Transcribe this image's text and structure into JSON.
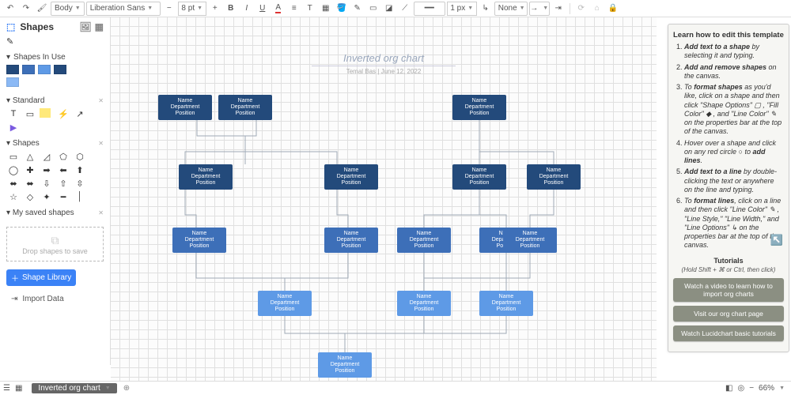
{
  "toolbar": {
    "style_select": "Body",
    "font_select": "Liberation Sans",
    "font_size": "8 pt",
    "line_width": "1 px",
    "arrow_start": "None"
  },
  "shapes_panel": {
    "title": "Shapes",
    "section_in_use": "Shapes In Use",
    "section_standard": "Standard",
    "section_shapes": "Shapes",
    "section_saved": "My saved shapes",
    "drop_hint": "Drop shapes to save",
    "lib_btn": "Shape Library",
    "import_btn": "Import Data"
  },
  "canvas": {
    "title": "Inverted org chart",
    "subtitle": "Temal Bas  |  June 12, 2022",
    "node_lines": [
      "Name",
      "Department",
      "Position"
    ]
  },
  "help": {
    "title": "Learn how to edit this template",
    "items": [
      {
        "bold": "Add text to a shape",
        "rest": " by selecting it and typing."
      },
      {
        "bold": "Add and remove shapes",
        "rest": " on the canvas."
      },
      {
        "pre": "To ",
        "bold": "format shapes",
        "rest": " as you'd like, click on a shape and then click \"Shape Options\" ▢ , \"Fill Color\" ◆ , and \"Line Color\" ✎ on the properties bar at the top of the canvas."
      },
      {
        "pre": "Hover over a shape and click on any red circle ○ to ",
        "bold": "add lines",
        "rest": "."
      },
      {
        "bold": "Add text to a line",
        "rest": " by double-clicking the text or anywhere on the line and typing."
      },
      {
        "pre": "To ",
        "bold": "format lines",
        "rest": ", click on a line and then click \"Line Color\" ✎ , \"Line Style,\" \"Line Width,\" and \"Line Options\" ↳ on the properties bar at the top of the canvas."
      }
    ],
    "tutorials_title": "Tutorials",
    "tutorials_sub": "(Hold Shift + ⌘ or Ctrl, then click)",
    "btn_video": "Watch a video to learn how to import org charts",
    "btn_page": "Visit our org chart page",
    "btn_basics": "Watch Lucidchart basic tutorials"
  },
  "bottom": {
    "doc_tab": "Inverted org chart",
    "zoom": "66%"
  },
  "colors": {
    "dk": "#234a7b",
    "md": "#3d6fb8",
    "lt": "#5e9ae6"
  }
}
